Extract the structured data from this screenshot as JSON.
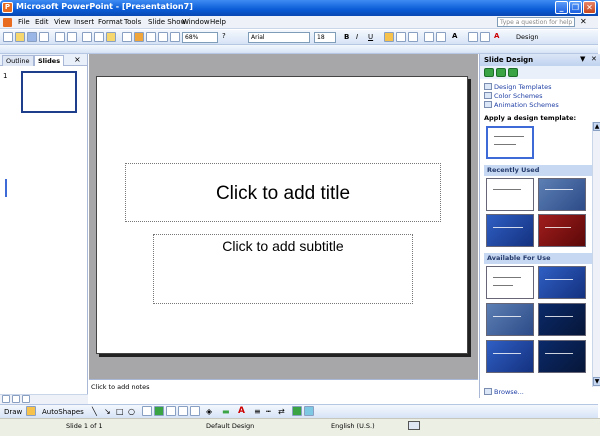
{
  "window": {
    "title": "Microsoft PowerPoint - [Presentation7]",
    "app_icon": "powerpoint-icon"
  },
  "menu": {
    "items": [
      "File",
      "Edit",
      "View",
      "Insert",
      "Format",
      "Tools",
      "Slide Show",
      "Window",
      "Help"
    ],
    "help_placeholder": "Type a question for help"
  },
  "toolbar": {
    "zoom": "68%",
    "font": "Arial",
    "font_size": "18",
    "bold": "B",
    "italic": "I",
    "underline": "U",
    "design_button": "Design"
  },
  "left_pane": {
    "tabs": [
      "Outline",
      "Slides"
    ],
    "close": "×",
    "slide_number": "1"
  },
  "slide": {
    "title_placeholder": "Click to add title",
    "subtitle_placeholder": "Click to add subtitle"
  },
  "notes": {
    "placeholder": "Click to add notes"
  },
  "task_pane": {
    "title": "Slide Design",
    "links": [
      "Design Templates",
      "Color Schemes",
      "Animation Schemes"
    ],
    "apply_label": "Apply a design template:",
    "sections": [
      "Recently Used",
      "Available For Use"
    ],
    "browse": "Browse..."
  },
  "drawing_toolbar": {
    "draw": "Draw",
    "autoshapes": "AutoShapes"
  },
  "status": {
    "slide": "Slide 1 of 1",
    "design": "Default Design",
    "language": "English (U.S.)"
  }
}
